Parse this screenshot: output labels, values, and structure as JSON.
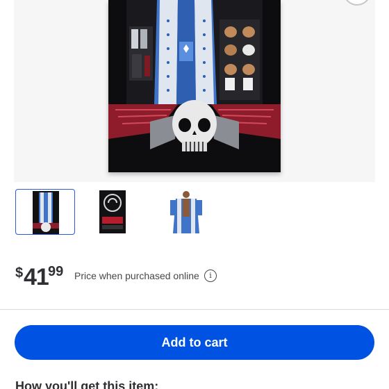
{
  "product": {
    "gallery": {
      "thumbnails": [
        {
          "name": "figure-box-front",
          "selected": true
        },
        {
          "name": "figure-box-back",
          "selected": false
        },
        {
          "name": "figure-loose",
          "selected": false
        }
      ]
    }
  },
  "price": {
    "currency_symbol": "$",
    "dollars": "41",
    "cents": "99",
    "note": "Price when purchased online",
    "info_icon": "info-icon"
  },
  "actions": {
    "add_to_cart": "Add to cart"
  },
  "sections": {
    "fulfillment_heading": "How you'll get this item:"
  },
  "colors": {
    "primary_button": "#0053e2",
    "selected_thumb_border": "#2a5ad9",
    "text": "#2e2f32"
  }
}
